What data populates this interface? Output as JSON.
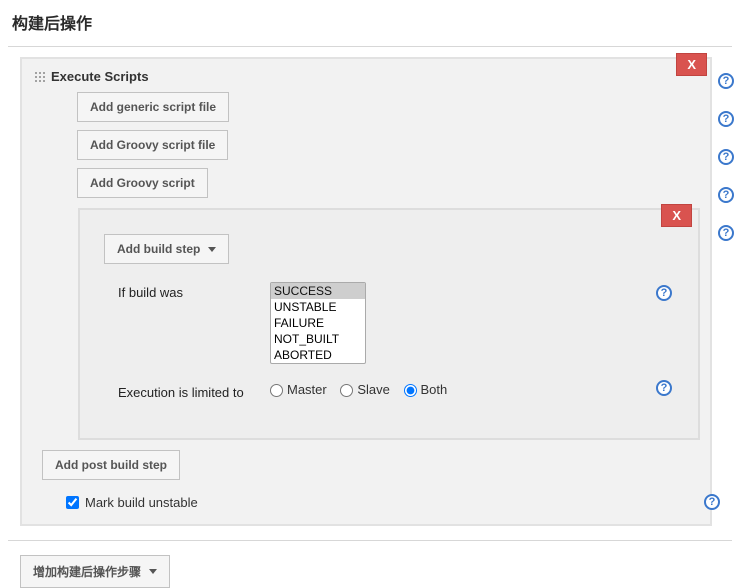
{
  "section": {
    "title": "构建后操作"
  },
  "outer": {
    "title": "Execute Scripts",
    "close": "X",
    "help": "?",
    "buttons": {
      "add_generic": "Add generic script file",
      "add_groovy_file": "Add Groovy script file",
      "add_groovy": "Add Groovy script",
      "add_post_build": "Add post build step"
    }
  },
  "inner": {
    "close": "X",
    "add_build_step": "Add build step",
    "if_build_was": {
      "label": "If build was",
      "options": [
        "SUCCESS",
        "UNSTABLE",
        "FAILURE",
        "NOT_BUILT",
        "ABORTED"
      ],
      "selected": "SUCCESS"
    },
    "execution_limit": {
      "label": "Execution is limited to",
      "options": {
        "master": "Master",
        "slave": "Slave",
        "both": "Both"
      },
      "selected": "both"
    }
  },
  "mark_unstable": {
    "label": "Mark build unstable",
    "checked": true
  },
  "footer": {
    "add_post_action": "增加构建后操作步骤"
  }
}
